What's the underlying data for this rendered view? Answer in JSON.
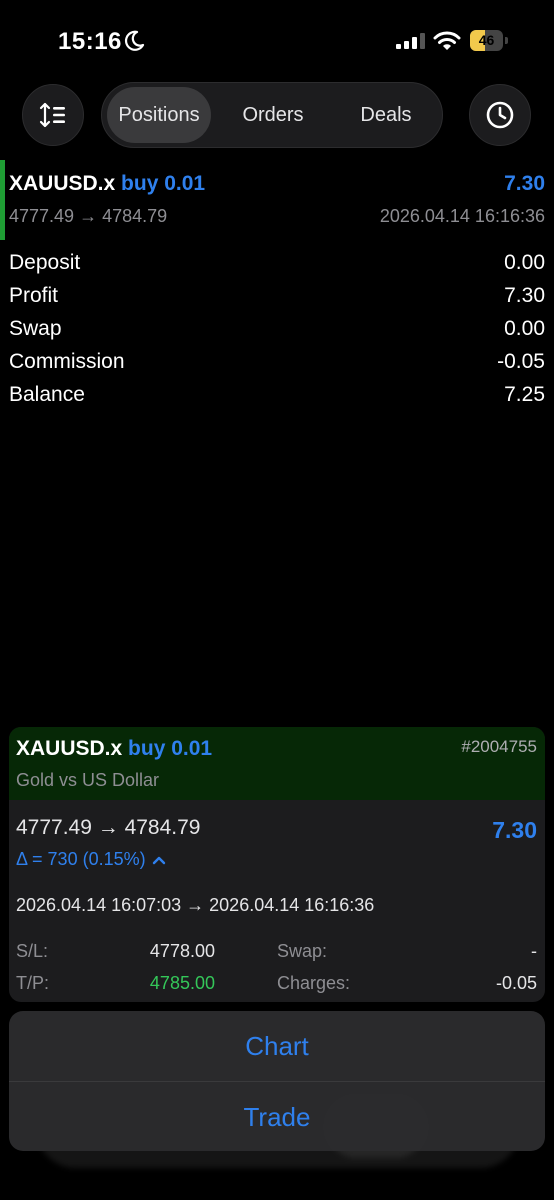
{
  "status_bar": {
    "time": "15:16",
    "battery_level": "46",
    "battery_fraction": 0.46,
    "icons": [
      "moon-icon",
      "cellular-signal-icon",
      "wifi-icon",
      "battery-icon"
    ]
  },
  "nav": {
    "sort_icon": "sort-icon",
    "tabs": [
      {
        "label": "Positions",
        "active": true
      },
      {
        "label": "Orders",
        "active": false
      },
      {
        "label": "Deals",
        "active": false
      }
    ],
    "history_icon": "clock-icon"
  },
  "deal": {
    "symbol": "XAUUSD.x",
    "type": "buy 0.01",
    "profit": "7.30",
    "prices": "4777.49 → 4784.79",
    "time": "2026.04.14 16:16:36"
  },
  "summary": [
    {
      "label": "Deposit",
      "value": "0.00"
    },
    {
      "label": "Profit",
      "value": "7.30"
    },
    {
      "label": "Swap",
      "value": "0.00"
    },
    {
      "label": "Commission",
      "value": "-0.05"
    },
    {
      "label": "Balance",
      "value": "7.25"
    }
  ],
  "detail": {
    "symbol": "XAUUSD.x",
    "type": "buy 0.01",
    "ticket": "#2004755",
    "description": "Gold vs US Dollar",
    "prices": "4777.49 → 4784.79",
    "profit": "7.30",
    "delta": "Δ = 730 (0.15%)",
    "times": "2026.04.14 16:07:03 → 2026.04.14 16:16:36",
    "sl_label": "S/L:",
    "sl_value": "4778.00",
    "tp_label": "T/P:",
    "tp_value": "4785.00",
    "swap_label": "Swap:",
    "swap_value": "-",
    "charges_label": "Charges:",
    "charges_value": "-0.05"
  },
  "action_sheet": {
    "chart_label": "Chart",
    "trade_label": "Trade"
  },
  "colors": {
    "accent_blue": "#2f80ed",
    "buy_green": "#1f9d34",
    "tp_green": "#34c759",
    "header_green": "#062806"
  }
}
